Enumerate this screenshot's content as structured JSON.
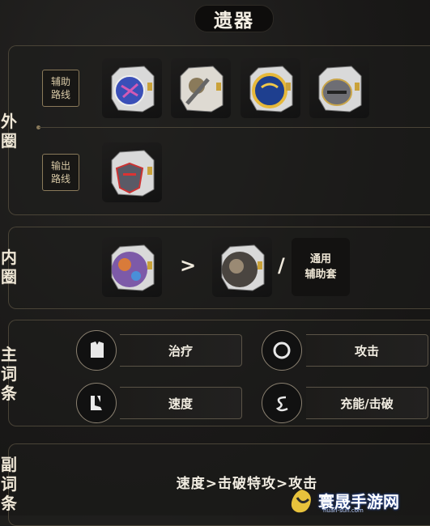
{
  "title": "遗器",
  "outer": {
    "label": [
      "外",
      "圈"
    ],
    "routes": [
      {
        "label_line1": "辅助",
        "label_line2": "路线",
        "relics": [
          "relic-1",
          "relic-2",
          "relic-3",
          "relic-4"
        ]
      },
      {
        "label_line1": "输出",
        "label_line2": "路线",
        "relics": [
          "relic-5"
        ]
      }
    ]
  },
  "inner": {
    "label": [
      "内",
      "圈"
    ],
    "gt": ">",
    "slash": "/",
    "generic_line1": "通用",
    "generic_line2": "辅助套"
  },
  "main_stats": {
    "label": [
      "主",
      "词",
      "条"
    ],
    "items": [
      {
        "text": "治疗",
        "icon": "body-armor-icon"
      },
      {
        "text": "攻击",
        "icon": "ring-icon"
      },
      {
        "text": "速度",
        "icon": "boots-icon"
      },
      {
        "text": "充能/击破",
        "icon": "rope-icon"
      }
    ]
  },
  "sub_stats": {
    "label": [
      "副",
      "词",
      "条"
    ],
    "text": "速度>击破特攻>攻击"
  },
  "watermark": {
    "name": "寰晟手游网",
    "url": "huan-sun.com"
  }
}
